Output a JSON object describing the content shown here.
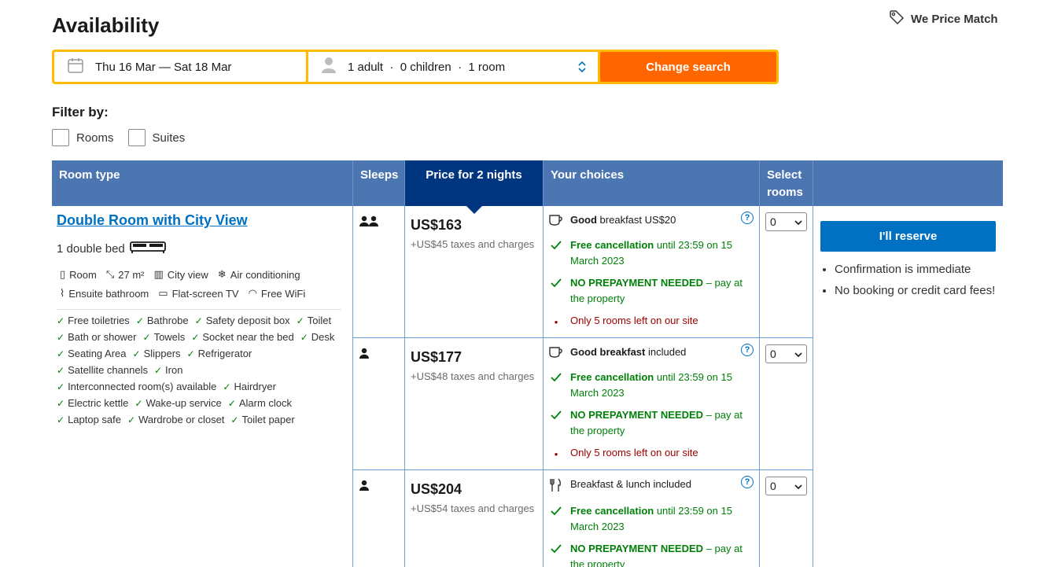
{
  "title": "Availability",
  "price_match": "We Price Match",
  "search": {
    "dates": "Thu 16 Mar — Sat 18 Mar",
    "guests": "1 adult  ·  0 children  ·  1 room",
    "button": "Change search"
  },
  "filter": {
    "label": "Filter by:",
    "options": [
      "Rooms",
      "Suites"
    ]
  },
  "table": {
    "headers": [
      "Room type",
      "Sleeps",
      "Price for 2 nights",
      "Your choices",
      "Select rooms"
    ]
  },
  "room": {
    "name": "Double Room with City View",
    "bed": "1 double bed",
    "facilities": [
      "Room",
      "27 m²",
      "City view",
      "Air conditioning",
      "Ensuite bathroom",
      "Flat-screen TV",
      "Free WiFi"
    ],
    "amenities": [
      "Free toiletries",
      "Bathrobe",
      "Safety deposit box",
      "Toilet",
      "Bath or shower",
      "Towels",
      "Socket near the bed",
      "Desk",
      "Seating Area",
      "Slippers",
      "Refrigerator",
      "Satellite channels",
      "Iron",
      "Interconnected room(s) available",
      "Hairdryer",
      "Electric kettle",
      "Wake-up service",
      "Alarm clock",
      "Laptop safe",
      "Wardrobe or closet",
      "Toilet paper"
    ]
  },
  "options": [
    {
      "price": "US$163",
      "taxes": "+US$45 taxes and charges",
      "meal_bold": "Good",
      "meal_rest": " breakfast US$20",
      "cancel_bold": "Free cancellation",
      "cancel_rest": " until 23:59 on 15 March 2023",
      "prepay_bold": "NO PREPAYMENT NEEDED",
      "prepay_rest": " – pay at the property",
      "scarcity": "Only 5 rooms left on our site",
      "select_value": "0"
    },
    {
      "price": "US$177",
      "taxes": "+US$48 taxes and charges",
      "meal_bold": "Good breakfast",
      "meal_rest": " included",
      "cancel_bold": "Free cancellation",
      "cancel_rest": " until 23:59 on 15 March 2023",
      "prepay_bold": "NO PREPAYMENT NEEDED",
      "prepay_rest": " – pay at the property",
      "scarcity": "Only 5 rooms left on our site",
      "select_value": "0"
    },
    {
      "price": "US$204",
      "taxes": "+US$54 taxes and charges",
      "meal_bold": "",
      "meal_rest": "Breakfast & lunch included",
      "cancel_bold": "Free cancellation",
      "cancel_rest": " until 23:59 on 15 March 2023",
      "prepay_bold": "NO PREPAYMENT NEEDED",
      "prepay_rest": " – pay at the property",
      "select_value": "0"
    }
  ],
  "reserve": {
    "button": "I'll reserve",
    "notes": [
      "Confirmation is immediate",
      "No booking or credit card fees!"
    ]
  },
  "colors": {
    "header_blue": "#4c76b2",
    "dark_blue": "#003580",
    "link_blue": "#0071c2",
    "orange": "#ff6600",
    "yellow": "#febb02",
    "green": "#008009",
    "red": "#a30000"
  }
}
